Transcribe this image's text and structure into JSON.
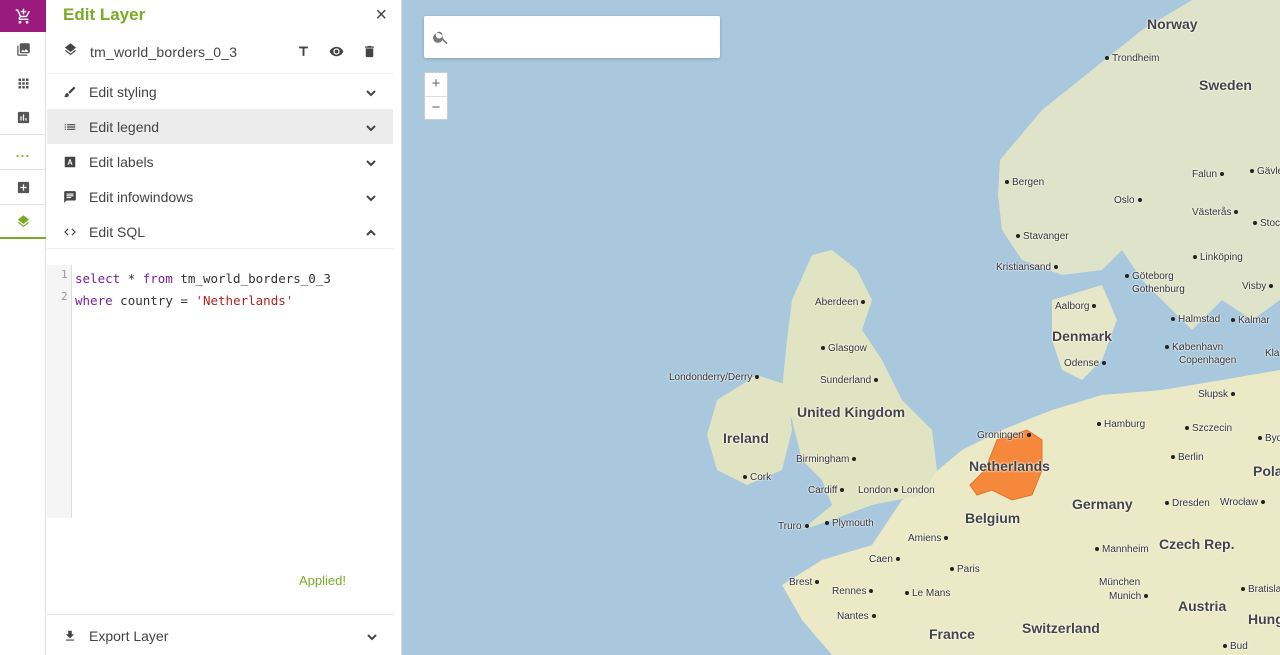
{
  "rail": {
    "items": [
      "cart-icon",
      "image-icon",
      "grid-icon",
      "chart-icon",
      "more-dots",
      "add-icon",
      "layers-icon"
    ],
    "dots": "..."
  },
  "panel": {
    "title": "Edit Layer",
    "close": "×",
    "layer_name": "tm_world_borders_0_3",
    "sections": [
      {
        "label": "Edit styling",
        "icon": "brush-icon"
      },
      {
        "label": "Edit legend",
        "icon": "list-icon"
      },
      {
        "label": "Edit labels",
        "icon": "label-a-icon"
      },
      {
        "label": "Edit infowindows",
        "icon": "comment-icon"
      },
      {
        "label": "Edit SQL",
        "icon": "code-icon"
      }
    ],
    "sql": {
      "line1_num": "1",
      "line2_num": "2",
      "line1_kw1": "select",
      "line1_mid": " * ",
      "line1_kw2": "from",
      "line1_rest": " tm_world_borders_0_3",
      "line2_kw": "where",
      "line2_mid": " country = ",
      "line2_str": "'Netherlands'"
    },
    "status": "Applied!",
    "export_label": "Export Layer"
  },
  "map": {
    "search_placeholder": "",
    "zoom_in": "+",
    "zoom_out": "−",
    "highlight_color": "#f5883a",
    "labels": {
      "norway": "Norway",
      "sweden": "Sweden",
      "trondheim": "Trondheim",
      "falun": "Falun",
      "gavle": "Gävle",
      "bergen": "Bergen",
      "oslo": "Oslo",
      "vasteras": "Västerås",
      "stockholm": "Stoc",
      "stavanger": "Stavanger",
      "linkoping": "Linköping",
      "kristiansand": "Kristiansand",
      "goteborg": "Göteborg",
      "gothenburg": "Gothenburg",
      "visby": "Visby",
      "aberdeen": "Aberdeen",
      "aalborg": "Aalborg",
      "denmark": "Denmark",
      "halmstad": "Halmstad",
      "kalmar": "Kalmar",
      "glasgow": "Glasgow",
      "kobenhavn": "København",
      "copenhagen": "Copenhagen",
      "odense": "Odense",
      "kla": "Kla",
      "londonderry": "Londonderry/Derry",
      "sunderland": "Sunderland",
      "slupsk": "Słupsk",
      "united_kingdom": "United Kingdom",
      "hamburg": "Hamburg",
      "szczecin": "Szczecin",
      "bydgoszcz": "Byd",
      "ireland": "Ireland",
      "groningen": "Groningen",
      "netherlands": "Netherlands",
      "berlin": "Berlin",
      "birmingham": "Birmingham",
      "poland": "Pola",
      "cork": "Cork",
      "cardiff": "Cardiff",
      "london1": "London",
      "london2": "London",
      "germany": "Germany",
      "wroclaw": "Wrocław",
      "belgium": "Belgium",
      "dresden": "Dresden",
      "truro": "Truro",
      "plymouth": "Plymouth",
      "amiens": "Amiens",
      "czech": "Czech Rep.",
      "caen": "Caen",
      "mannheim": "Mannheim",
      "paris": "Paris",
      "brest": "Brest",
      "munchen": "München",
      "munich": "Munich",
      "rennes": "Rennes",
      "lemans": "Le Mans",
      "austria": "Austria",
      "bratislava": "Bratislav",
      "nantes": "Nantes",
      "france": "France",
      "switzerland": "Switzerland",
      "hungary": "Hung",
      "budapest": "Bud"
    }
  }
}
